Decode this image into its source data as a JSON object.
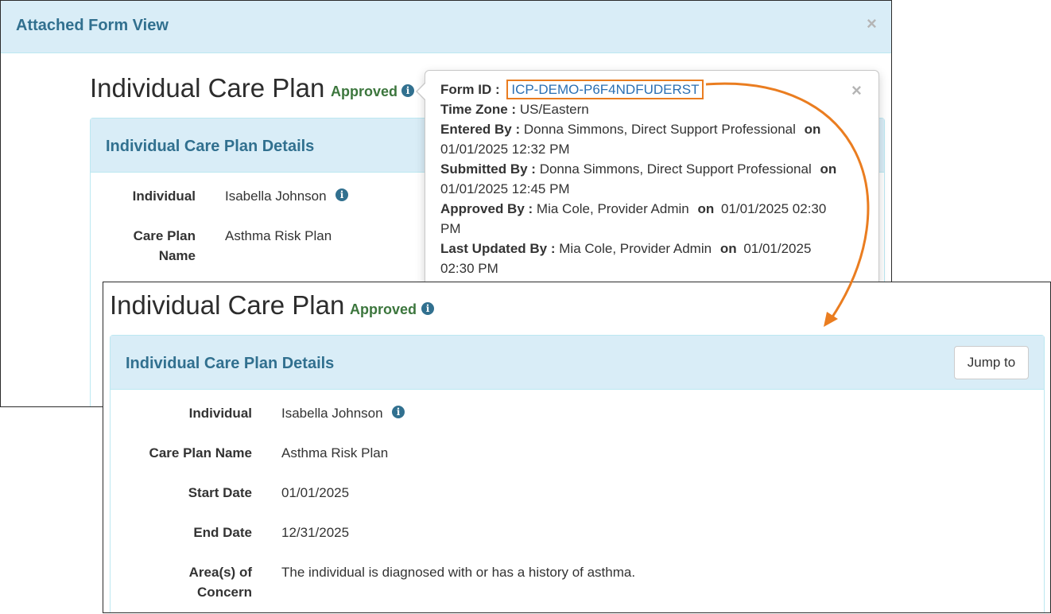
{
  "modal": {
    "title": "Attached Form View",
    "close_glyph": "×"
  },
  "form": {
    "heading": "Individual Care Plan",
    "status": "Approved",
    "status_color": "#3c763d",
    "panel_title": "Individual Care Plan Details",
    "jump_label": "Jump to"
  },
  "popover": {
    "close_glyph": "×",
    "form_id_label": "Form ID :",
    "form_id_value": "ICP-DEMO-P6F4NDFUDERST",
    "time_zone_label": "Time Zone :",
    "time_zone_value": "US/Eastern",
    "entered_by_label": "Entered By :",
    "entered_by_value": "Donna Simmons, Direct Support Professional",
    "entered_on_label": "on",
    "entered_on_value": "01/01/2025 12:32 PM",
    "submitted_by_label": "Submitted By :",
    "submitted_by_value": "Donna Simmons, Direct Support Professional",
    "submitted_on_label": "on",
    "submitted_on_value": "01/01/2025 12:45 PM",
    "approved_by_label": "Approved By :",
    "approved_by_value": "Mia Cole, Provider Admin",
    "approved_on_label": "on",
    "approved_on_value_part1": "01/01/2025 02:30",
    "approved_on_value_part2": "PM",
    "updated_by_label": "Last Updated By :",
    "updated_by_value": "Mia Cole, Provider Admin",
    "updated_on_label": "on",
    "updated_on_value_part1": "01/01/2025",
    "updated_on_value_part2": "02:30 PM"
  },
  "back_fields": {
    "individual_label": "Individual",
    "individual_value": "Isabella Johnson",
    "care_plan_label_line1": "Care Plan",
    "care_plan_label_line2": "Name",
    "care_plan_value": "Asthma Risk Plan"
  },
  "front_fields": {
    "individual_label": "Individual",
    "individual_value": "Isabella Johnson",
    "care_plan_label": "Care Plan Name",
    "care_plan_value": "Asthma Risk Plan",
    "start_label": "Start Date",
    "start_value": "01/01/2025",
    "end_label": "End Date",
    "end_value": "12/31/2025",
    "concern_label_line1": "Area(s) of",
    "concern_label_line2": "Concern",
    "concern_value": "The individual is diagnosed with or has a history of asthma."
  },
  "colors": {
    "accent": "#31708f",
    "highlight": "#ea7d20",
    "link": "#2a6fb3"
  },
  "icons": {
    "info": "info-circle-icon",
    "close": "close-icon",
    "arrow": "curved-arrow-annotation"
  }
}
